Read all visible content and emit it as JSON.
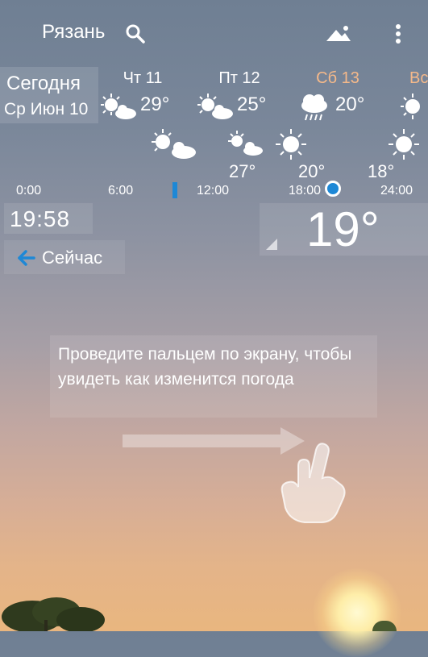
{
  "header": {
    "city": "Рязань",
    "icons": [
      "search-icon",
      "landscape-icon",
      "more-vert-icon"
    ]
  },
  "today": {
    "label": "Сегодня",
    "date": "Ср Июн 10"
  },
  "days": [
    {
      "name": "Чт 11",
      "temp": "29°",
      "icon": "sun-cloud-icon",
      "color": "#ffffff"
    },
    {
      "name": "Пт 12",
      "temp": "25°",
      "icon": "sun-cloud-icon",
      "color": "#ffffff"
    },
    {
      "name": "Сб 13",
      "temp": "20°",
      "icon": "rain-icon",
      "color": "#f5b98a"
    },
    {
      "name": "Вс",
      "temp": "",
      "icon": "sun-icon",
      "color": "#f5b98a"
    }
  ],
  "hourly": {
    "temps": [
      "27°",
      "20°",
      "18°"
    ],
    "times": [
      "0:00",
      "6:00",
      "12:00",
      "18:00",
      "24:00"
    ]
  },
  "current": {
    "time": "19:58",
    "temp": "19°",
    "now_label": "Сейчас"
  },
  "hint": {
    "text": "Проведите пальцем по экрану, чтобы увидеть как изменится погода"
  },
  "colors": {
    "accent": "#1e88d6",
    "weekend": "#f5b98a"
  }
}
